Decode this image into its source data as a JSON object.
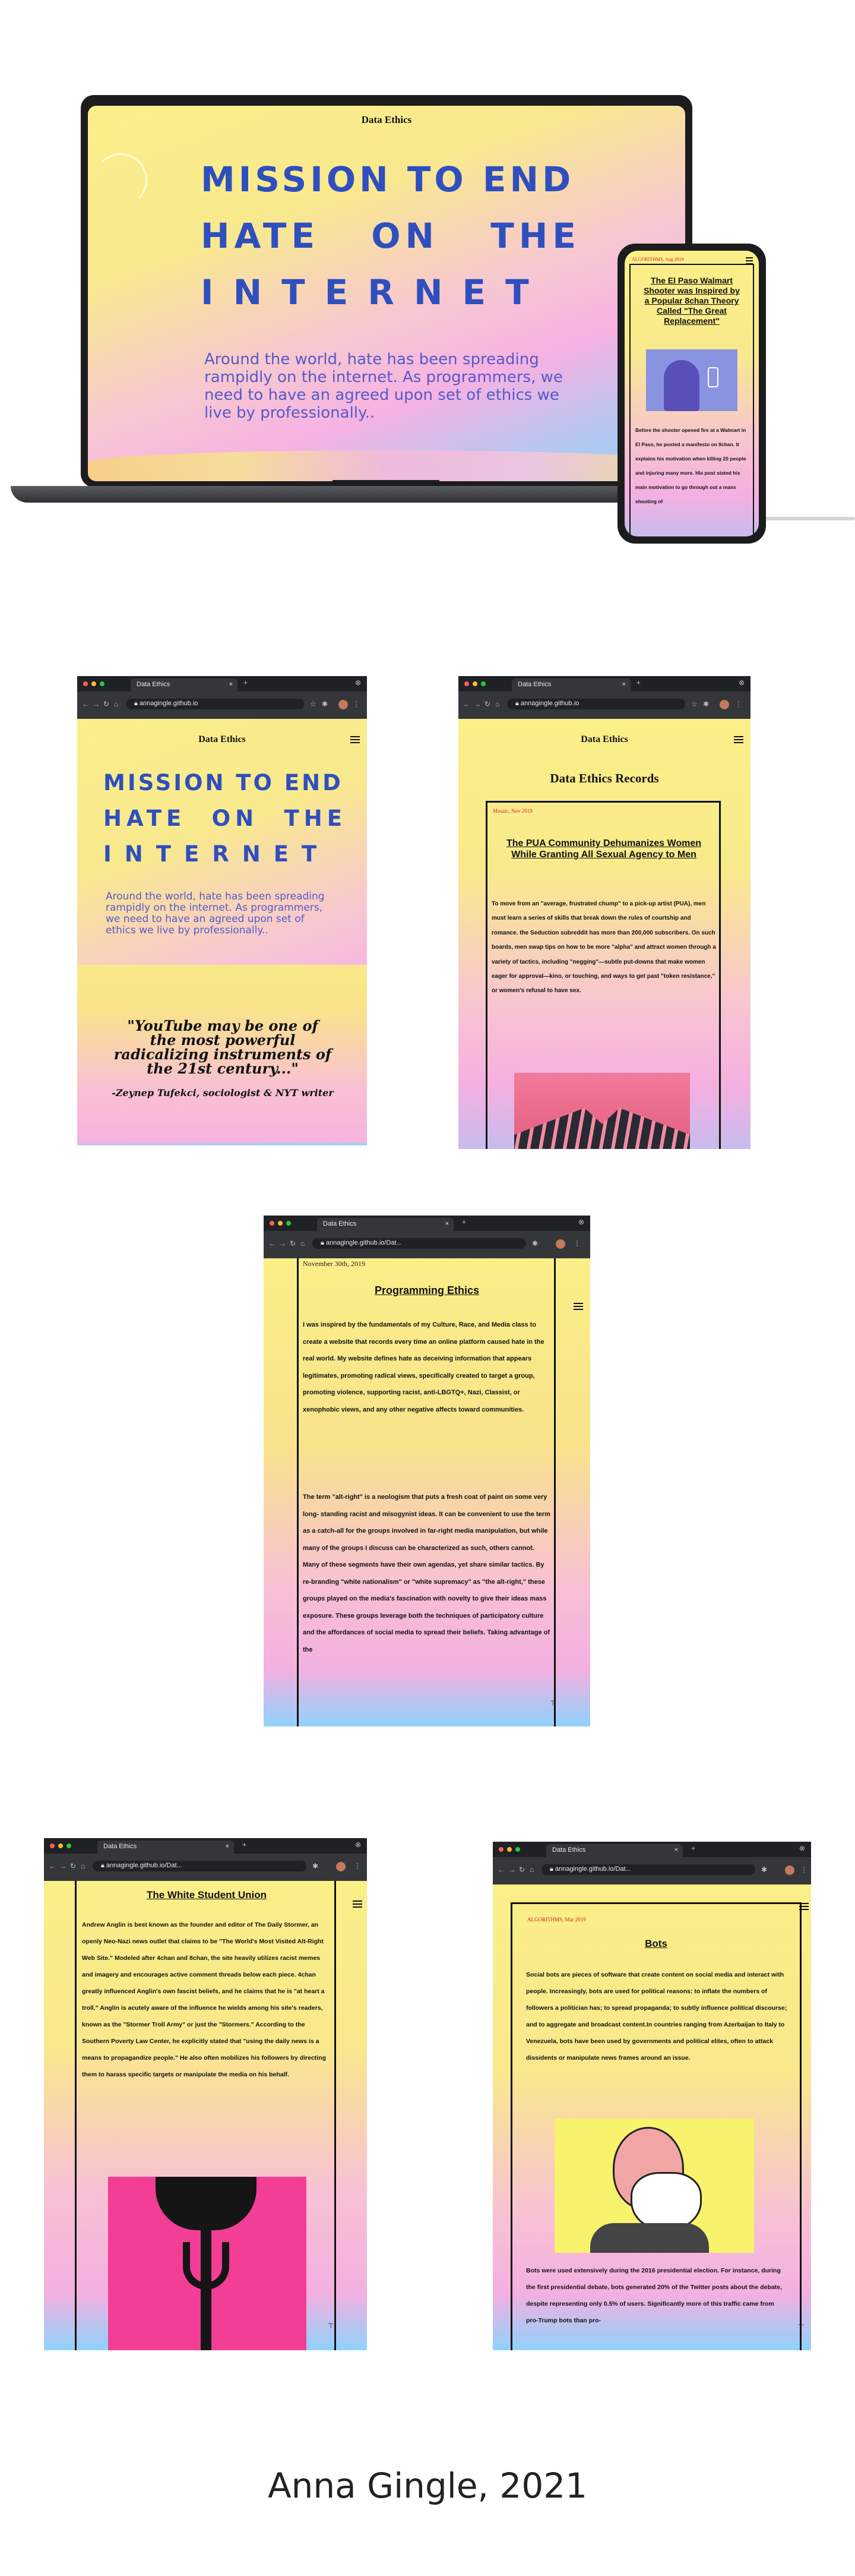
{
  "site": {
    "title": "Data Ethics"
  },
  "hero": {
    "line1": "MISSION TO END",
    "line2": "HATE ON THE",
    "line3": "INTERNET",
    "desc": "Around the world, hate has been spreading rampidly on the internet. As programmers, we need to have an agreed upon set of ethics we live by professionally.."
  },
  "phone_mock": {
    "date": "ALGORITHMS, Aug 2019",
    "headline": "The El Paso Walmart Shooter was Inspired by a Popular 8chan Theory Called \"The Great Replacement\"",
    "body": "Before the shooter opened fire at a Walmart in El Paso, he posted a manifesto on 8chan. It explains his motivation when killing 20 people and injuring many more. His post stated his main motivation to go through out a mass shooting of"
  },
  "browser": {
    "tab_label": "Data Ethics",
    "url": "annagingle.github.io",
    "url_short": "annagingle.github.io/Dat..."
  },
  "quote": {
    "text": "\"YouTube may be one of the most powerful radicalizing instruments of the 21st century...\"",
    "author": "-Zeynep Tufekci, sociologist & NYT writer"
  },
  "records": {
    "heading": "Data Ethics Records",
    "date": "Mosaic, Nov 2019",
    "headline": "The PUA Community Dehumanizes Women While Granting All Sexual Agency to Men",
    "body": "To move from an \"average, frustrated chump\" to a pick-up artist (PUA), men must learn a series of skills that break down the rules of courtship and romance. the Seduction subreddit has more than 200,000 subscribers. On such boards, men swap tips on how to be more \"alpha\" and attract women through a variety of tactics, including \"negging\"—subtle put-downs that make women eager for approval—kino, or touching, and ways to get past \"token resistance,\" or women's refusal to have sex."
  },
  "programming": {
    "date": "November 30th, 2019",
    "heading": "Programming Ethics",
    "para1": "I was inspired by the fundamentals of my Culture, Race, and Media class to create a website that records every time an online platform caused hate in the real world. My website defines hate as deceiving information that appears legitimates, promoting radical views, specifically created to target a group, promoting violence, supporting racist, anti-LBGTQ+, Nazi, Classist, or xenophobic views, and any other negative affects toward communities.",
    "para2": "The term \"alt-right\" is a neologism that puts a fresh coat of paint on some very long- standing racist and misogynist ideas. It can be convenient to use the term as a catch-all for the groups involved in far-right media manipulation, but while many of the groups I discuss can be characterized as such, others cannot. Many of these segments have their own agendas, yet share similar tactics. By re-branding \"white nationalism\" or \"white supremacy\" as \"the alt-right,\" these groups played on the media's fascination with novelty to give their ideas mass exposure. These groups leverage both the techniques of participatory culture and the affordances of social media to spread their beliefs. Taking advantage of the"
  },
  "student_union": {
    "heading": "The White Student Union",
    "body": "Andrew Anglin is best known as the founder and editor of The Daily Stormer, an openly Neo-Nazi news outlet that claims to be \"The World's Most Visited Alt-Right Web Site.\" Modeled after 4chan and 8chan, the site heavily utilizes racist memes and imagery and encourages active comment threads below each piece. 4chan greatly influenced Anglin's own fascist beliefs, and he claims that he is \"at heart a troll.\" Anglin is acutely aware of the influence he wields among his site's readers, known as the \"Stormer Troll Army\" or just the \"Stormers.\" According to the Southern Poverty Law Center, he explicitly stated that \"using the daily news is a means to propagandize people.\" He also often mobilizes his followers by directing them to harass specific targets or manipulate the media on his behalf."
  },
  "bots": {
    "date": "ALGORITHMS, Mar 2019",
    "heading": "Bots",
    "para1": "Social bots are pieces of software that create content on social media and interact with people. Increasingly, bots are used for political reasons: to inflate the numbers of followers a politician has; to spread propaganda; to subtly influence political discourse; and to aggregate and broadcast content.In countries ranging from Azerbaijan to Italy to Venezuela, bots have been used by governments and political elites, often to attack dissidents or manipulate news frames around an issue.",
    "para2": "Bots were used extensively during the 2016 presidential election. For instance, during the first presidential debate, bots generated 20% of the Twitter posts about the debate, despite representing only 0.5% of users. Significantly more of this traffic came from pro-Trump bots than pro-"
  },
  "credit": "Anna Gingle, 2021",
  "colors": {
    "accent_blue": "#2f4fbf",
    "date_red": "#d02020",
    "chrome_dark": "#202124"
  }
}
